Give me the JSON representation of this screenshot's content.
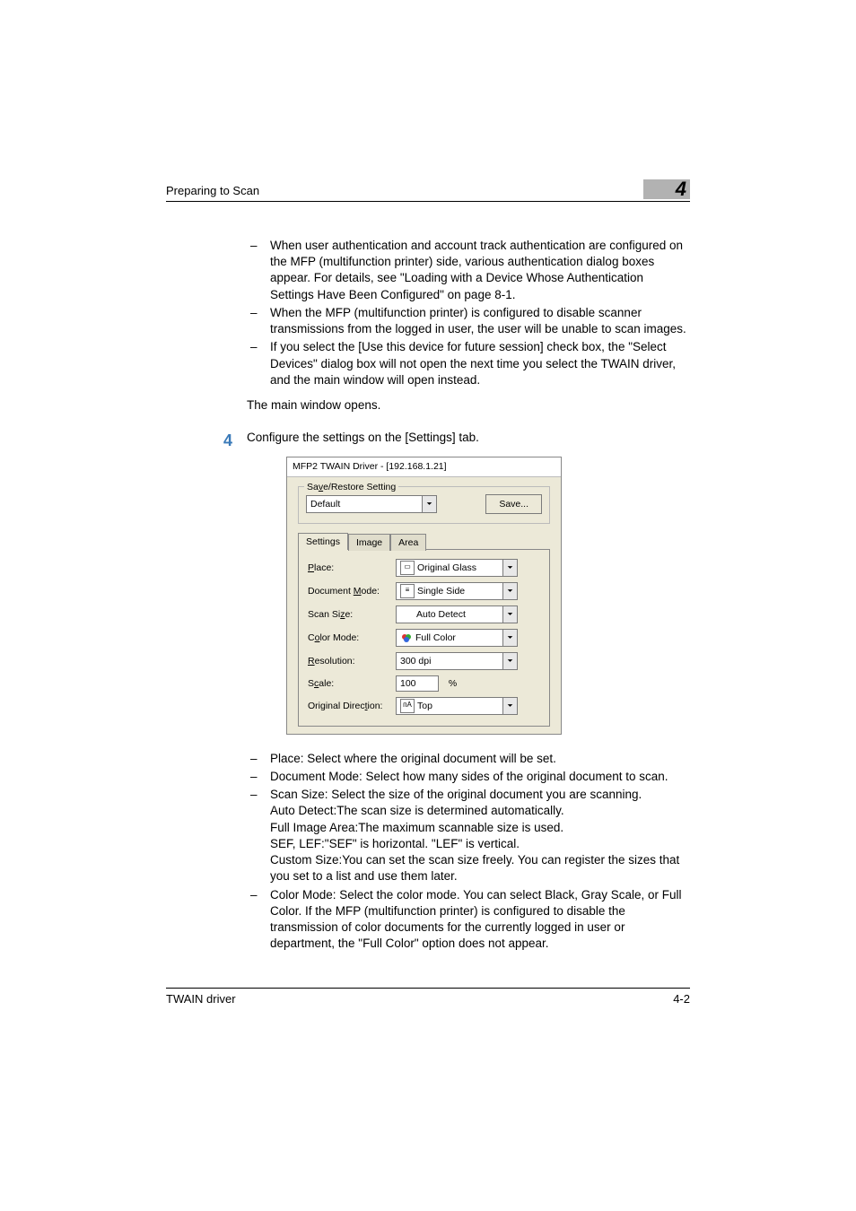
{
  "header": {
    "title": "Preparing to Scan",
    "chapter": "4"
  },
  "bullets1": [
    "When user authentication and account track authentication are configured on the MFP (multifunction printer) side, various authentication dialog boxes appear. For details, see \"Loading with a Device Whose Authentication Settings Have Been Configured\" on page 8-1.",
    "When the MFP (multifunction printer) is configured to disable scanner transmissions from the logged in user, the user will be unable to scan images.",
    "If you select the [Use this device for future session] check box, the \"Select Devices\" dialog box will not open the next time you select the TWAIN driver, and the main window will open instead."
  ],
  "line_after": "The main window opens.",
  "step": {
    "num": "4",
    "text": "Configure the settings on the [Settings] tab."
  },
  "dialog": {
    "title": "MFP2 TWAIN Driver - [192.168.1.21]",
    "legend": "Save/Restore Setting",
    "preset": "Default",
    "save_btn": "Save...",
    "tabs": [
      "Settings",
      "Image",
      "Area"
    ],
    "fields": {
      "place_label": "Place:",
      "place_value": "Original Glass",
      "mode_label": "Document Mode:",
      "mode_value": "Single Side",
      "size_label": "Scan Size:",
      "size_value": "Auto Detect",
      "color_label": "Color Mode:",
      "color_value": "Full Color",
      "res_label": "Resolution:",
      "res_value": "300 dpi",
      "scale_label": "Scale:",
      "scale_value": "100",
      "scale_unit": "%",
      "dir_label": "Original Direction:",
      "dir_value": "Top"
    }
  },
  "bullets2": [
    {
      "text": "Place: Select where the original document will be set."
    },
    {
      "text": "Document Mode: Select how many sides of the original document to scan."
    },
    {
      "text": "Scan Size: Select the size of the original document you are scanning.",
      "subs": [
        {
          "b": "Auto Detect",
          "t": ":The scan size is determined automatically."
        },
        {
          "b": "Full Image Area",
          "t": ":The maximum scannable size is used."
        },
        {
          "b": "SEF, LEF",
          "t": ":\"SEF\" is horizontal. \"LEF\" is vertical."
        },
        {
          "b": "Custom Size",
          "t": ":You can set the scan size freely. You can register the sizes that you set to a list and use them later."
        }
      ]
    },
    {
      "text": "Color Mode: Select the color mode. You can select Black, Gray Scale, or Full Color. If the MFP (multifunction printer) is configured to disable the transmission of color documents for the currently logged in user or department, the \"Full Color\" option does not appear."
    }
  ],
  "footer": {
    "left": "TWAIN driver",
    "right": "4-2"
  }
}
